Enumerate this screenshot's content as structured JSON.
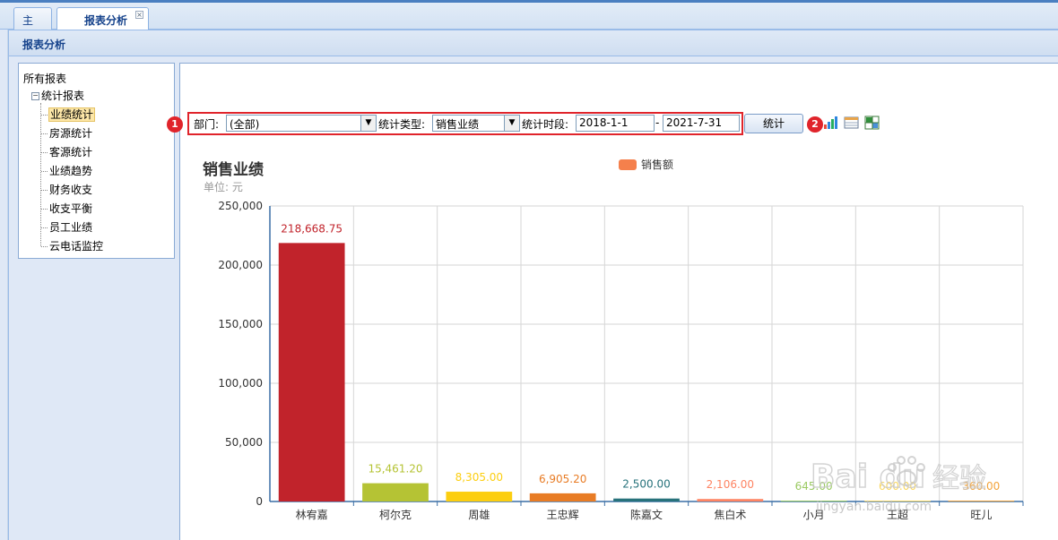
{
  "tabs": {
    "home": "主页",
    "active": "报表分析",
    "close": "×"
  },
  "header": {
    "title": "报表分析"
  },
  "tree": {
    "root": "所有报表",
    "group": "统计报表",
    "items": [
      "业绩统计",
      "房源统计",
      "客源统计",
      "业绩趋势",
      "财务收支",
      "收支平衡",
      "员工业绩",
      "云电话监控"
    ]
  },
  "filters": {
    "dept_label": "部门:",
    "dept_value": "(全部)",
    "type_label": "统计类型:",
    "type_value": "销售业绩",
    "period_label": "统计时段:",
    "date_from": "2018-1-1",
    "date_sep": "-",
    "date_to": "2021-7-31",
    "submit": "统计"
  },
  "annotations": {
    "badge1": "1",
    "badge2": "2"
  },
  "icons": [
    "bar-chart-icon",
    "table-icon",
    "export-excel-icon"
  ],
  "colors": {
    "annotation_red": "#e0242b",
    "legend": "#f5804c"
  },
  "chart_data": {
    "type": "bar",
    "title": "销售业绩",
    "subtitle": "单位: 元",
    "legend": [
      "销售额"
    ],
    "legend_position": "top-center",
    "grid": true,
    "ylim": [
      0,
      250000
    ],
    "yticks": [
      "0",
      "50,000",
      "100,000",
      "150,000",
      "200,000",
      "250,000"
    ],
    "categories": [
      "林宥嘉",
      "柯尔克",
      "周雄",
      "王忠辉",
      "陈嘉文",
      "焦白术",
      "小月",
      "王超",
      "旺儿"
    ],
    "values": [
      218668.75,
      15461.2,
      8305.0,
      6905.2,
      2500.0,
      2106.0,
      645.0,
      600.0,
      360.0
    ],
    "labels": [
      "218,668.75",
      "15,461.20",
      "8,305.00",
      "6,905.20",
      "2,500.00",
      "2,106.00",
      "645.00",
      "600.00",
      "360.00"
    ],
    "colors": [
      "#c1232b",
      "#b5c334",
      "#fcce10",
      "#e87c25",
      "#27727b",
      "#fe8463",
      "#9bca63",
      "#fad860",
      "#f3a43b"
    ]
  },
  "watermark": {
    "brand": "Baidu经验",
    "url": "jingyan.baidu.com"
  }
}
